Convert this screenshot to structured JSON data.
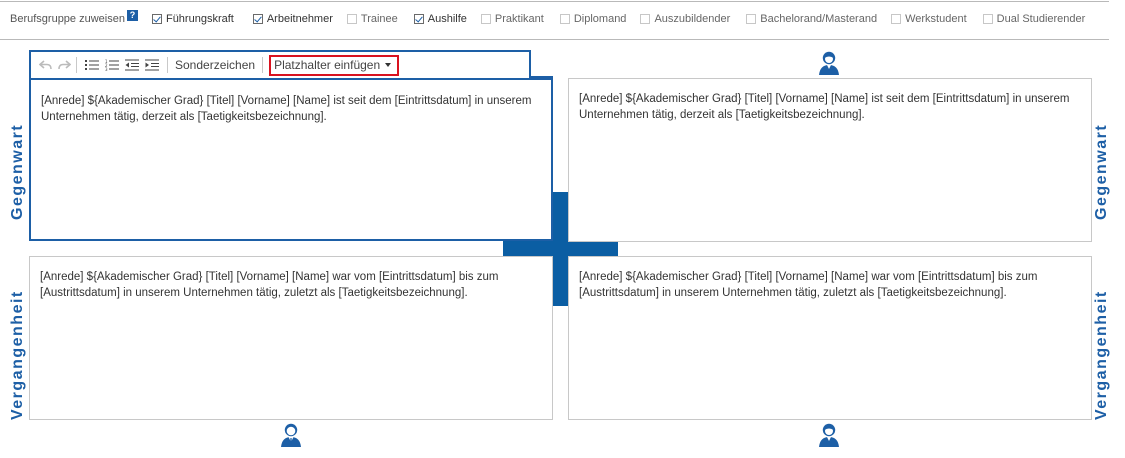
{
  "header": {
    "group_label": "Berufsgruppe zuweisen",
    "help_icon": "?",
    "groups": [
      {
        "label": "Führungskraft",
        "checked": true
      },
      {
        "label": "Arbeitnehmer",
        "checked": true
      },
      {
        "label": "Trainee",
        "checked": false
      },
      {
        "label": "Aushilfe",
        "checked": true
      },
      {
        "label": "Praktikant",
        "checked": false
      },
      {
        "label": "Diplomand",
        "checked": false
      },
      {
        "label": "Auszubildender",
        "checked": false
      },
      {
        "label": "Bachelorand/Masterand",
        "checked": false
      },
      {
        "label": "Werkstudent",
        "checked": false
      },
      {
        "label": "Dual Studierender",
        "checked": false
      }
    ]
  },
  "toolbar": {
    "undo_icon": "undo-icon",
    "redo_icon": "redo-icon",
    "bullet_list_icon": "bullet-list-icon",
    "numbered_list_icon": "numbered-list-icon",
    "outdent_icon": "outdent-icon",
    "indent_icon": "indent-icon",
    "special_chars_label": "Sonderzeichen",
    "placeholder_label": "Platzhalter einfügen"
  },
  "labels": {
    "present": "Gegenwart",
    "past": "Vergangenheit"
  },
  "panels": {
    "present_male": "[Anrede] ${Akademischer Grad} [Titel] [Vorname] [Name] ist seit dem [Eintrittsdatum] in unserem Unternehmen tätig, derzeit als [Taetigkeitsbezeichnung].",
    "present_female": "[Anrede] ${Akademischer Grad} [Titel] [Vorname] [Name] ist seit dem [Eintrittsdatum] in unserem Unternehmen tätig, derzeit als [Taetigkeitsbezeichnung].",
    "past_male": "[Anrede] ${Akademischer Grad} [Titel] [Vorname] [Name] war vom [Eintrittsdatum] bis zum [Austrittsdatum] in unserem Unternehmen tätig, zuletzt als [Taetigkeitsbezeichnung].",
    "past_female": "[Anrede] ${Akademischer Grad} [Titel] [Vorname] [Name] war vom [Eintrittsdatum] bis zum [Austrittsdatum] in unserem Unternehmen tätig, zuletzt als [Taetigkeitsbezeichnung]."
  },
  "colors": {
    "accent": "#1d5fa6",
    "cross": "#0b5ea3",
    "highlight": "#d9121f"
  }
}
